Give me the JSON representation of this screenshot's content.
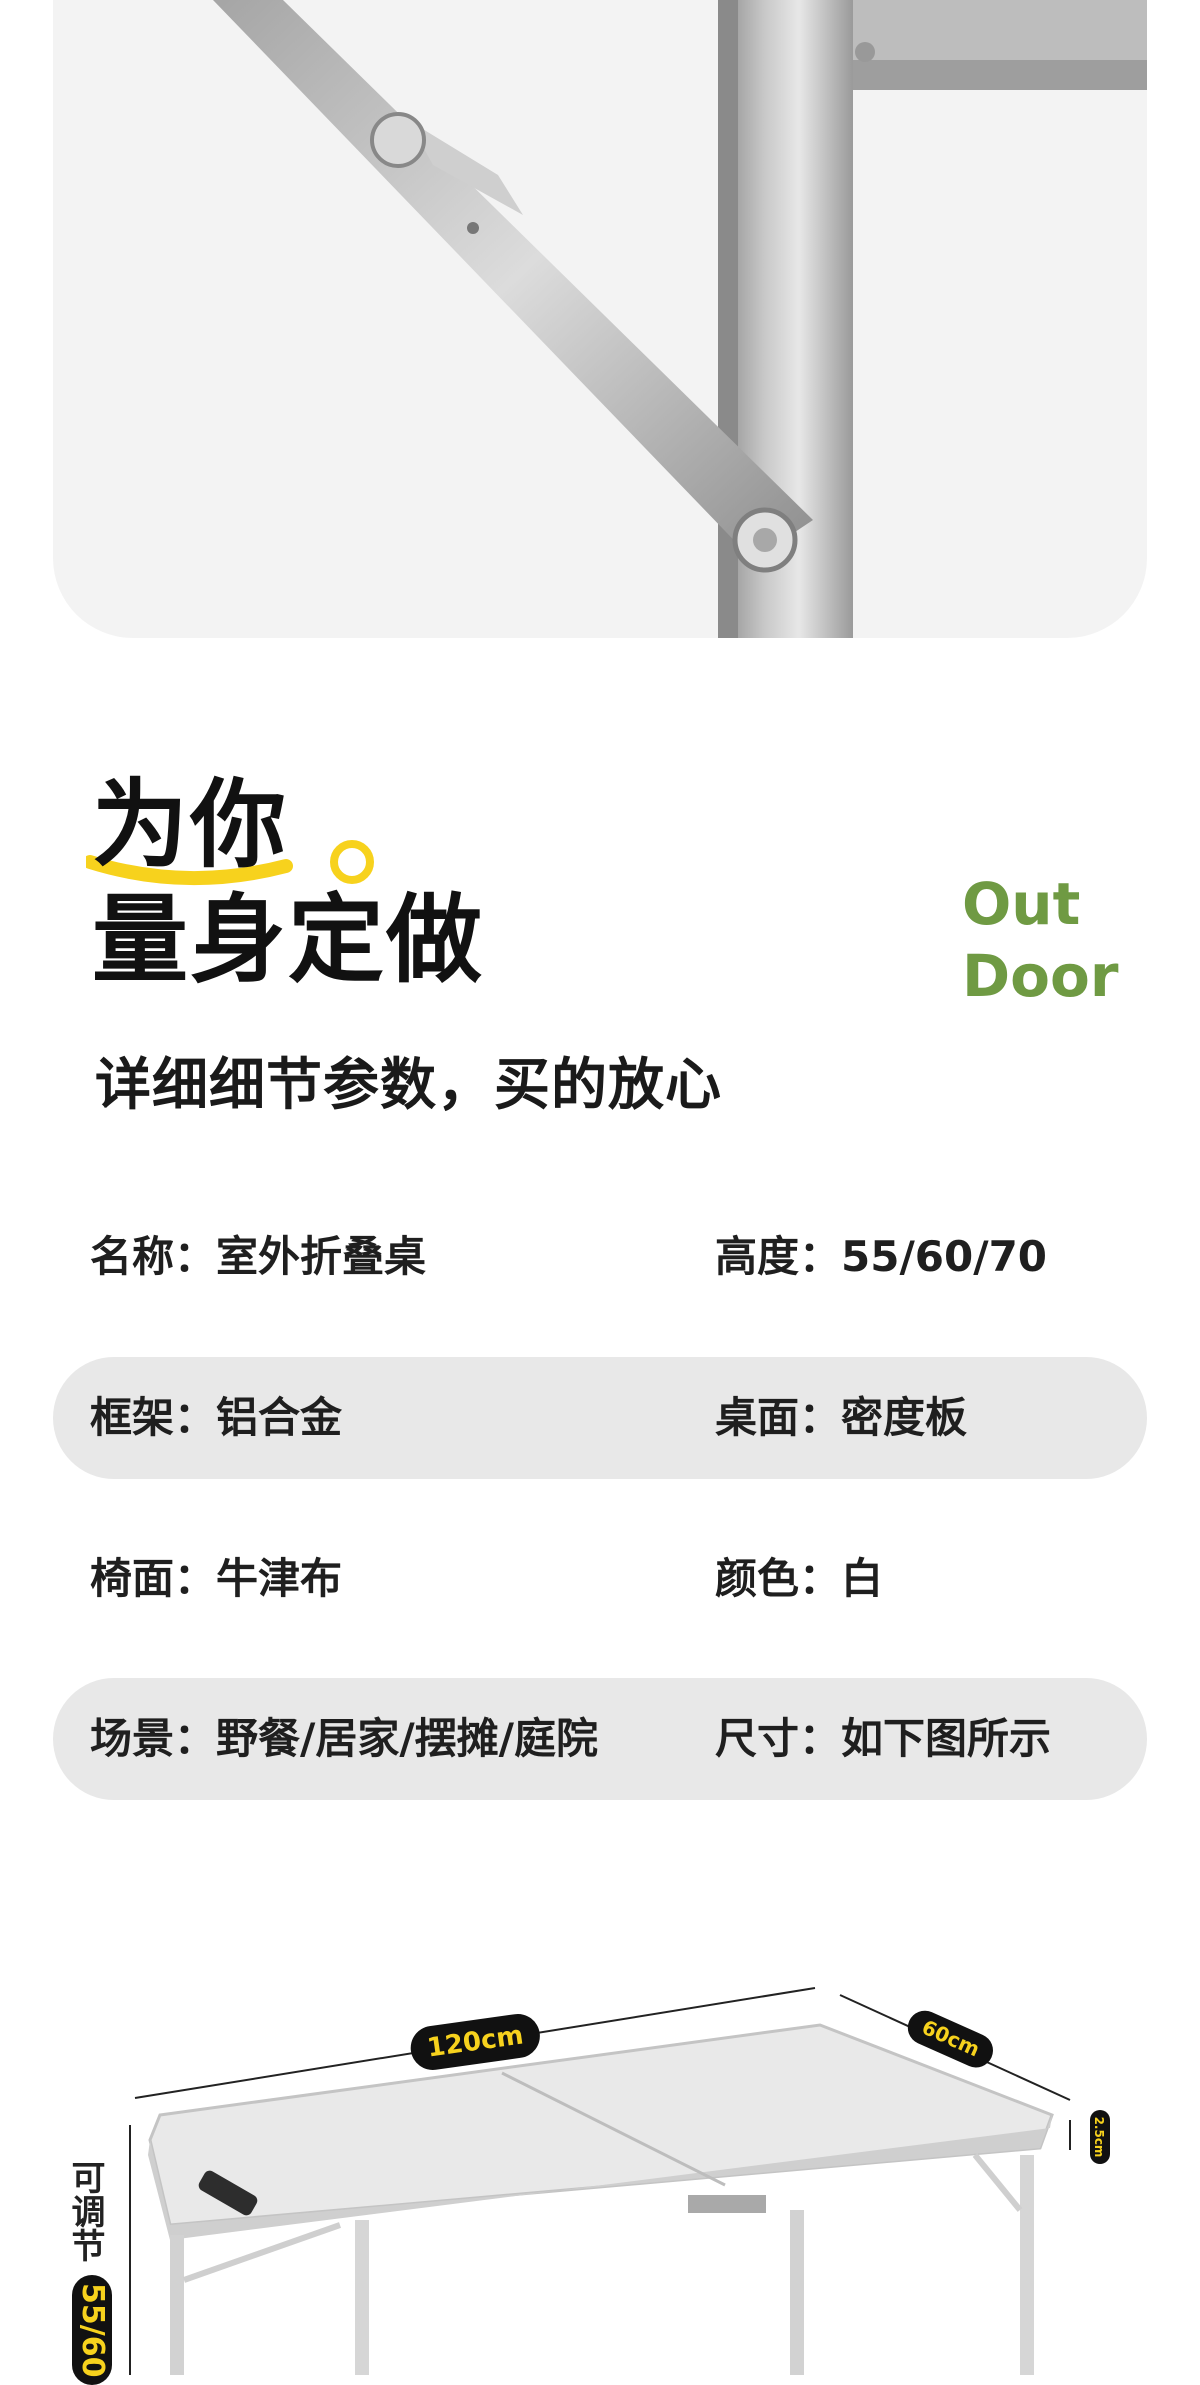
{
  "headline": {
    "line1": "为你",
    "line2": "量身定做",
    "brand_line1": "Out",
    "brand_line2": "Door",
    "subtitle": "详细细节参数，买的放心"
  },
  "specs": [
    {
      "left": "名称：室外折叠桌",
      "right": "高度：55/60/70",
      "shaded": false
    },
    {
      "left": "框架：铝合金",
      "right": "桌面：密度板",
      "shaded": true
    },
    {
      "left": "椅面：牛津布",
      "right": "颜色：白",
      "shaded": false
    },
    {
      "left": "场景：野餐/居家/摆摊/庭院",
      "right": "尺寸：如下图所示",
      "shaded": true
    }
  ],
  "dimensions": {
    "length": "120cm",
    "width": "60cm",
    "thickness": "2.5cm",
    "adjustable_label": "可调节",
    "height": "55/60"
  },
  "colors": {
    "accent_yellow": "#f7d21d",
    "brand_green": "#6f9a43",
    "row_shade": "#e8e8e8"
  }
}
